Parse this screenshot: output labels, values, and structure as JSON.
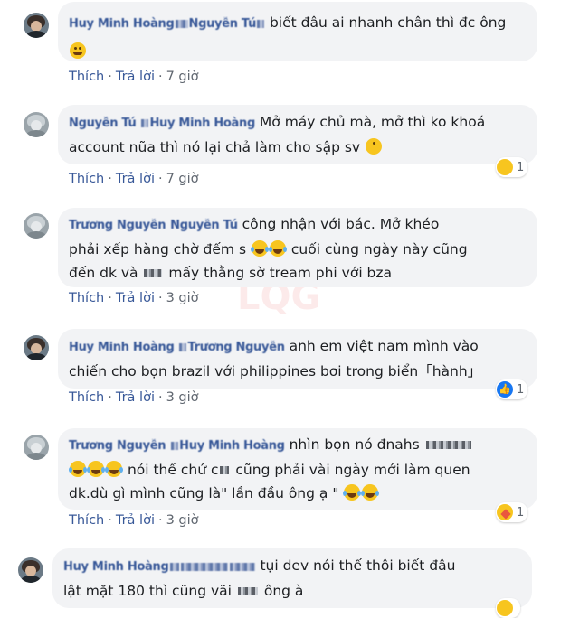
{
  "actions": {
    "like": "Thích",
    "reply": "Trả lời",
    "separator": "·"
  },
  "comments": [
    {
      "name": "Huy Minh Hoàng",
      "name2": "Nguyễn Tú",
      "text": "biết đâu ai nhanh chân thì đc ông",
      "time": "7 giờ"
    },
    {
      "name": "Nguyễn Tú",
      "name2": "Huy Minh Hoàng",
      "text1": "Mở máy chủ mà, mở thì ko khoá",
      "text2": "account nữa thì nó lại chả làm cho sập sv",
      "time": "7 giờ",
      "reaction_count": "1"
    },
    {
      "name": "Trương Nguyễn",
      "name2": "Nguyễn Tú",
      "text1": "công nhận với bác. Mở khéo",
      "text2a": "phải xếp hàng chờ đếm s",
      "text2b": "cuối cùng ngày này cũng",
      "text3a": "đến dk và",
      "text3b": "mấy thằng sờ tream phi với bza",
      "time": "3 giờ"
    },
    {
      "name": "Huy Minh Hoàng",
      "name2": "Trương Nguyễn",
      "text1": "anh em việt nam mình vào",
      "text2": "chiến cho bọn brazil với philippines bơi trong biển「hành」",
      "time": "3 giờ",
      "reaction_count": "1"
    },
    {
      "name": "Trương Nguyễn",
      "name2": "Huy Minh Hoàng",
      "text1": "nhìn bọn nó đnahs",
      "text2a": "nói thế chứ c",
      "text2b": "cũng phải vài ngày mới làm quen",
      "text3": "dk.dù gì mình cũng là\" lần đầu ông ạ \"",
      "time": "3 giờ",
      "reaction_count": "1"
    },
    {
      "name": "Huy Minh Hoàng",
      "text1": "tụi dev nói thế thôi biết đâu",
      "text2a": "lật mặt 180 thì cũng vãi",
      "text2b": "ông à"
    }
  ]
}
